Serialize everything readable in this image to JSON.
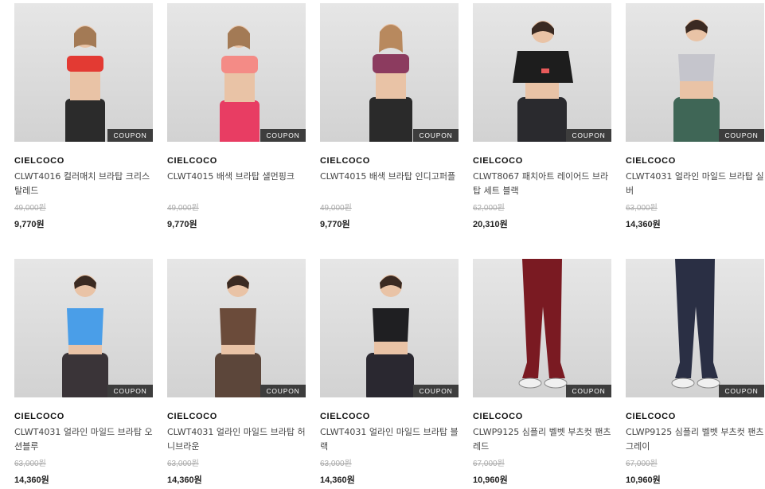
{
  "products": [
    {
      "brand": "CIELCOCO",
      "name": "CLWT4016 컬러매치 브라탑 크리스탈레드",
      "original_price": "49,000원",
      "price": "9,770원",
      "badge": "COUPON",
      "top_color": "#e33a33",
      "bottom_color": "#2b2b2b"
    },
    {
      "brand": "CIELCOCO",
      "name": "CLWT4015 배색 브라탑 샐먼핑크",
      "original_price": "49,000원",
      "price": "9,770원",
      "badge": "COUPON",
      "top_color": "#f48b86",
      "bottom_color": "#e83d63"
    },
    {
      "brand": "CIELCOCO",
      "name": "CLWT4015 배색 브라탑 인디고퍼플",
      "original_price": "49,000원",
      "price": "9,770원",
      "badge": "COUPON",
      "top_color": "#8c3b5f",
      "bottom_color": "#2a2a2a"
    },
    {
      "brand": "CIELCOCO",
      "name": "CLWT8067 패치아트 레이어드 브라탑 세트 블랙",
      "original_price": "62,000원",
      "price": "20,310원",
      "badge": "COUPON",
      "top_color": "#1d1d1d",
      "bottom_color": "#2a2a2e"
    },
    {
      "brand": "CIELCOCO",
      "name": "CLWT4031 얼라인 마일드 브라탑 실버",
      "original_price": "63,000원",
      "price": "14,360원",
      "badge": "COUPON",
      "top_color": "#c5c5cc",
      "bottom_color": "#3f6656"
    },
    {
      "brand": "CIELCOCO",
      "name": "CLWT4031 얼라인 마일드 브라탑 오션블루",
      "original_price": "63,000원",
      "price": "14,360원",
      "badge": "COUPON",
      "top_color": "#4a9ee8",
      "bottom_color": "#3a3438"
    },
    {
      "brand": "CIELCOCO",
      "name": "CLWT4031 얼라인 마일드 브라탑 허니브라운",
      "original_price": "63,000원",
      "price": "14,360원",
      "badge": "COUPON",
      "top_color": "#6b4b3a",
      "bottom_color": "#5c463a"
    },
    {
      "brand": "CIELCOCO",
      "name": "CLWT4031 얼라인 마일드 브라탑 블랙",
      "original_price": "63,000원",
      "price": "14,360원",
      "badge": "COUPON",
      "top_color": "#1f1f22",
      "bottom_color": "#2a2830"
    },
    {
      "brand": "CIELCOCO",
      "name": "CLWP9125 심플리 벨벳 부츠컷 팬츠 레드",
      "original_price": "67,000원",
      "price": "10,960원",
      "badge": "COUPON",
      "top_color": "#7a1a22",
      "bottom_color": "#7a1a22"
    },
    {
      "brand": "CIELCOCO",
      "name": "CLWP9125 심플리 벨벳 부츠컷 팬츠 그레이",
      "original_price": "67,000원",
      "price": "10,960원",
      "badge": "COUPON",
      "top_color": "#2a2f44",
      "bottom_color": "#2a2f44"
    }
  ]
}
